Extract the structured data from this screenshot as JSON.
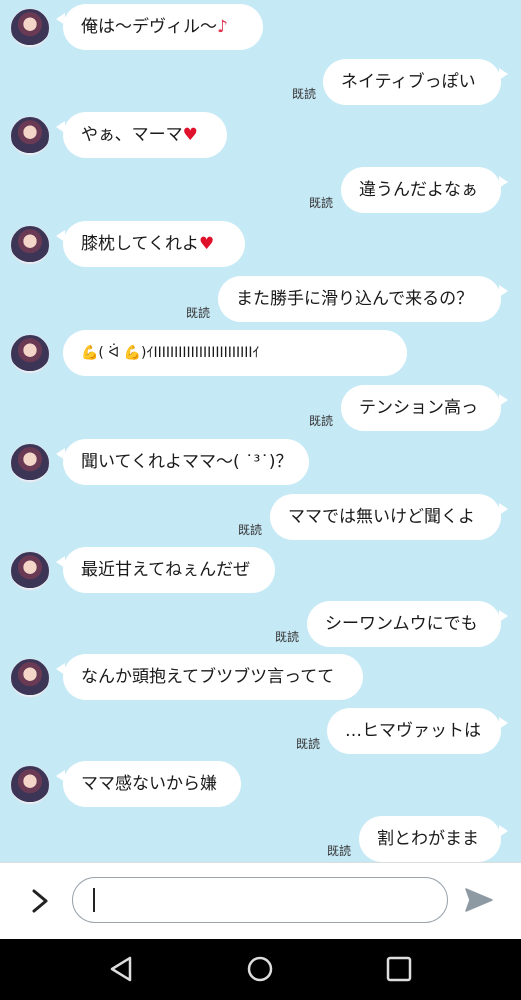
{
  "chat": {
    "read_label": "既読",
    "messages": [
      {
        "dir": "in",
        "text": "俺は〜デヴィル〜",
        "emoji": "♪",
        "emoji_kind": "note"
      },
      {
        "dir": "out",
        "text": "ネイティブっぽい"
      },
      {
        "dir": "in",
        "text": "やぁ、マーマ",
        "emoji": "♥",
        "emoji_kind": "heart"
      },
      {
        "dir": "out",
        "text": "違うんだよなぁ"
      },
      {
        "dir": "in",
        "text": "膝枕してくれよ",
        "emoji": "♥",
        "emoji_kind": "heart"
      },
      {
        "dir": "out",
        "text": "また勝手に滑り込んで来るの？"
      },
      {
        "dir": "in",
        "text": "💪( ᐛ 💪)ｲIIIIIIIIIIIIIIIIIIIIIIIIｲ"
      },
      {
        "dir": "out",
        "text": "テンション高っ"
      },
      {
        "dir": "in",
        "text": "聞いてくれよママ〜( ˙³˙)？"
      },
      {
        "dir": "out",
        "text": "ママでは無いけど聞くよ"
      },
      {
        "dir": "in",
        "text": "最近甘えてねぇんだぜ"
      },
      {
        "dir": "out",
        "text": "シーワンムウにでも"
      },
      {
        "dir": "in",
        "text": "なんか頭抱えてブツブツ言ってて"
      },
      {
        "dir": "out",
        "text": "…ヒマヴァットは"
      },
      {
        "dir": "in",
        "text": "ママ感ないから嫌"
      },
      {
        "dir": "out",
        "text": "割とわがまま"
      }
    ]
  },
  "input": {
    "placeholder": ""
  },
  "icons": {
    "expand": "chevron-right-icon",
    "send": "send-icon",
    "nav_back": "triangle-back-icon",
    "nav_home": "circle-home-icon",
    "nav_recent": "square-recent-icon"
  },
  "colors": {
    "background": "#c6e9f6",
    "bubble": "#ffffff",
    "heart": "#e0112b",
    "nav_bar": "#000000"
  }
}
